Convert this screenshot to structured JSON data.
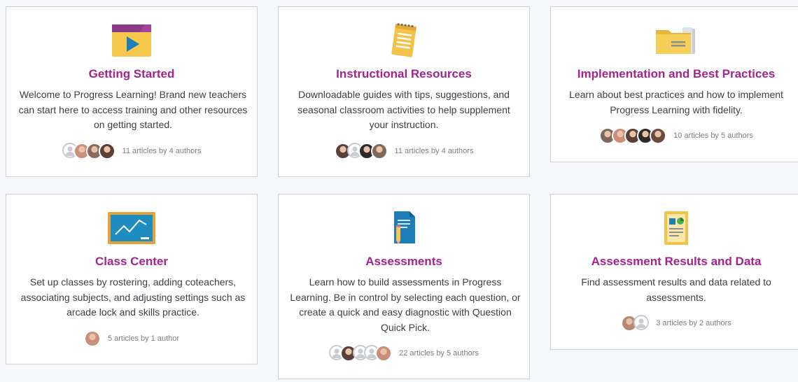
{
  "cards": [
    {
      "title": "Getting Started",
      "description": "Welcome to Progress Learning! Brand new teachers can start here to access training and other resources on getting started.",
      "count": "11 articles by 4 authors",
      "icon": "video-play-icon",
      "authors": [
        "placeholder",
        "#c98f78",
        "#8a6a5c",
        "#5b4038"
      ]
    },
    {
      "title": "Instructional Resources",
      "description": "Downloadable guides with tips, suggestions, and seasonal classroom activities to help supplement your instruction.",
      "count": "11 articles by 4 authors",
      "icon": "notepad-icon",
      "authors": [
        "#5b4038",
        "placeholder",
        "#2e2a28",
        "#7d6a5d"
      ]
    },
    {
      "title": "Implementation and Best Practices",
      "description": "Learn about best practices and how to implement Progress Learning with fidelity.",
      "count": "10 articles by 5 authors",
      "icon": "folder-icon",
      "authors": [
        "#7d6a5d",
        "#c98f78",
        "#5b4038",
        "#2e2a28",
        "#6b4a3f"
      ]
    },
    {
      "title": "Class Center",
      "description": "Set up classes by rostering, adding coteachers, associating subjects, and adjusting settings such as arcade lock and skills practice.",
      "count": "5 articles by 1 author",
      "icon": "chalkboard-chart-icon",
      "authors": [
        "#c98f78"
      ]
    },
    {
      "title": "Assessments",
      "description": "Learn how to build assessments in Progress Learning. Be in control by selecting each question, or create a quick and easy diagnostic with Question Quick Pick.",
      "count": "22 articles by 5 authors",
      "icon": "document-pencil-icon",
      "authors": [
        "placeholder",
        "#5b4038",
        "placeholder",
        "placeholder",
        "#c98f78"
      ]
    },
    {
      "title": "Assessment Results and Data",
      "description": "Find assessment results and data related to assessments.",
      "count": "3 articles by 2 authors",
      "icon": "report-chart-icon",
      "authors": [
        "#b88a74",
        "placeholder"
      ]
    }
  ]
}
